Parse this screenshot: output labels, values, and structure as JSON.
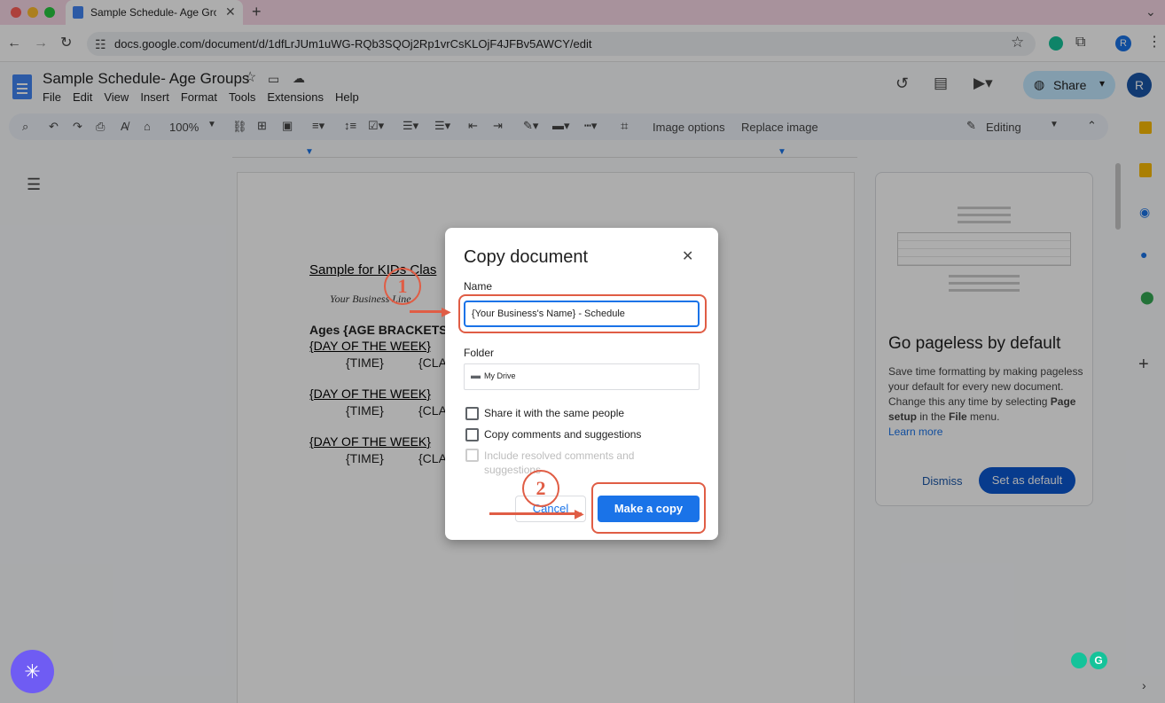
{
  "browser": {
    "tab_title": "Sample Schedule- Age Group",
    "new_tab": "+",
    "url": "docs.google.com/document/d/1dfLrJUm1uWG-RQb3SQOj2Rp1vrCsKLOjF4JFBv5AWCY/edit",
    "profile_initial": "R"
  },
  "docs": {
    "title": "Sample Schedule- Age Groups",
    "menu": [
      "File",
      "Edit",
      "View",
      "Insert",
      "Format",
      "Tools",
      "Extensions",
      "Help"
    ],
    "share_label": "Share",
    "avatar_initial": "R",
    "zoom": "100%",
    "image_options": "Image options",
    "replace_image": "Replace image",
    "editing": "Editing"
  },
  "document": {
    "heading": "Sample for KIDs Clas",
    "logo_text": "Your Business Line",
    "ages": "Ages {AGE BRACKETS",
    "day": "{DAY OF THE WEEK}",
    "time": "{TIME}",
    "cla": "{CLA"
  },
  "sidecard": {
    "title": "Go pageless by default",
    "body_1": "Save time formatting by making pageless your default for every new document. Change this any time by selecting ",
    "bold_1": "Page setup",
    "body_2": " in the ",
    "bold_2": "File",
    "body_3": " menu.",
    "learn_more": "Learn more",
    "dismiss": "Dismiss",
    "set_default": "Set as default"
  },
  "dialog": {
    "title": "Copy document",
    "name_label": "Name",
    "name_value": "{Your Business's Name} - Schedule",
    "folder_label": "Folder",
    "folder_value": "My Drive",
    "opt_share": "Share it with the same people",
    "opt_comments": "Copy comments and suggestions",
    "opt_resolved": "Include resolved comments and suggestions",
    "cancel": "Cancel",
    "make_copy": "Make a copy"
  },
  "annotations": {
    "step1": "1",
    "step2": "2"
  },
  "colors": {
    "accent": "#1a73e8",
    "annotation": "#e05d45",
    "share_bg": "#c2e7ff"
  }
}
